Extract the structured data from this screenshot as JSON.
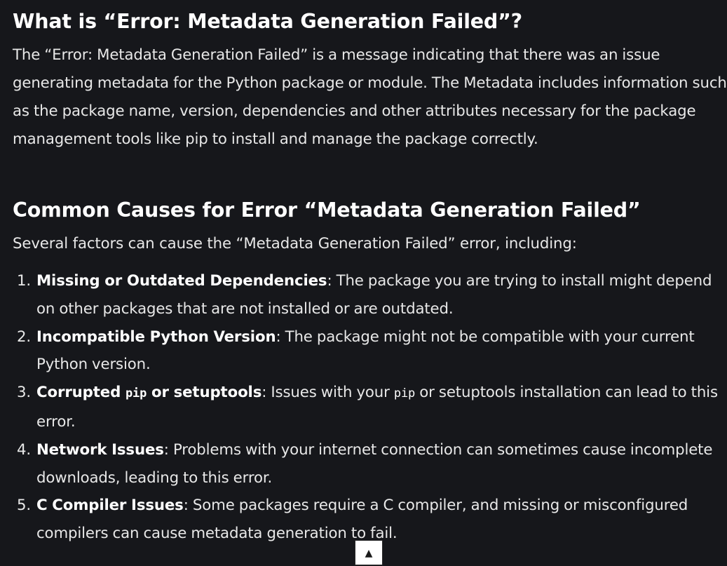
{
  "article": {
    "heading_what": "What is “Error: Metadata Generation Failed”?",
    "intro": "The “Error: Metadata Generation Failed” is a message indicating that there was an issue generating metadata for the Python package or module. The Metadata includes information such as the package name, version, dependencies and other attributes necessary for the package management tools like pip to install and manage the package correctly.",
    "heading_causes": "Common Causes for Error “Metadata Generation Failed”",
    "causes_lead": "Several factors can cause the “Metadata Generation Failed” error, including:",
    "causes": [
      {
        "number": "1.",
        "term": "Missing or Outdated Dependencies",
        "text": ": The package you are trying to install might depend on other packages that are not installed or are outdated."
      },
      {
        "number": "2.",
        "term": "Incompatible Python Version",
        "text": ": The package might not be compatible with your current Python version."
      },
      {
        "number": "3.",
        "term_before": "Corrupted ",
        "term_code": "pip",
        "term_after": " or setuptools",
        "text_before": ": Issues with your ",
        "text_code": "pip",
        "text_after": " or setuptools installation can lead to this error."
      },
      {
        "number": "4.",
        "term": "Network Issues",
        "text": ": Problems with your internet connection can sometimes cause incomplete downloads, leading to this error."
      },
      {
        "number": "5.",
        "term": "C Compiler Issues",
        "text": ": Some packages require a C compiler, and missing or misconfigured compilers can cause metadata generation to fail."
      }
    ]
  },
  "back_to_top": {
    "icon": "arrow-up-icon",
    "glyph": "▲"
  }
}
